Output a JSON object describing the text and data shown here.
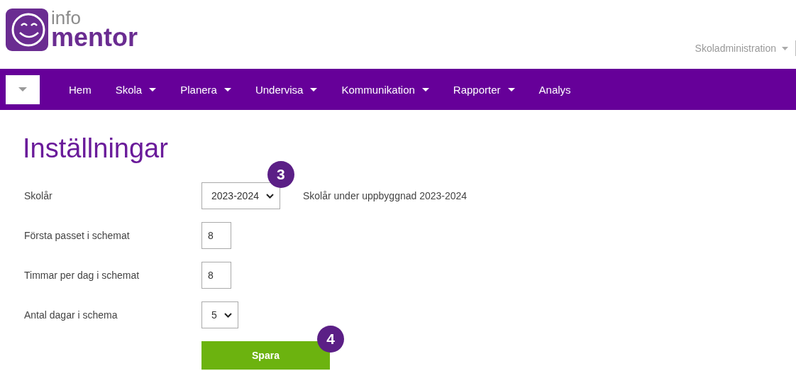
{
  "logo": {
    "top": "info",
    "bottom": "mentor"
  },
  "user_menu": {
    "label": "Skoladministration"
  },
  "nav": [
    {
      "label": "Hem",
      "has_menu": false
    },
    {
      "label": "Skola",
      "has_menu": true
    },
    {
      "label": "Planera",
      "has_menu": true
    },
    {
      "label": "Undervisa",
      "has_menu": true
    },
    {
      "label": "Kommunikation",
      "has_menu": true
    },
    {
      "label": "Rapporter",
      "has_menu": true
    },
    {
      "label": "Analys",
      "has_menu": false
    }
  ],
  "page_title": "Inställningar",
  "form": [
    {
      "label": "Skolår",
      "kind": "select",
      "value": "2023-2024",
      "note": "Skolår under uppbyggnad 2023-2024",
      "step": "3"
    },
    {
      "label": "Första passet i schemat",
      "kind": "input",
      "value": "8"
    },
    {
      "label": "Timmar per dag i schemat",
      "kind": "input",
      "value": "8"
    },
    {
      "label": "Antal dagar i schema",
      "kind": "select",
      "value": "5"
    }
  ],
  "save_button": {
    "label": "Spara",
    "step": "4"
  }
}
